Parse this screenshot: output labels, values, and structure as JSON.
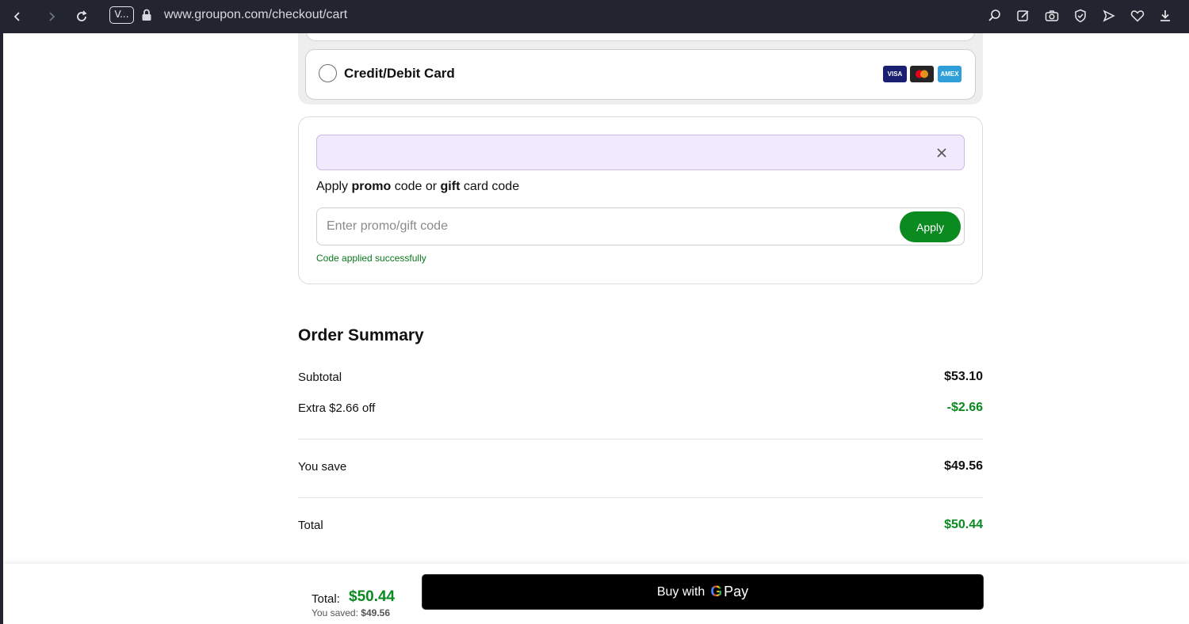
{
  "browser": {
    "url": "www.groupon.com/checkout/cart",
    "tab_badge": "V..."
  },
  "payment": {
    "option_label": "Credit/Debit Card",
    "card_logos": [
      {
        "name": "VISA",
        "color": "#1a1f71"
      },
      {
        "name": "mastercard",
        "color": "#252525"
      },
      {
        "name": "AMEX",
        "color": "#2e9fd8"
      }
    ]
  },
  "promo": {
    "title_parts": [
      "Apply ",
      "promo",
      " code or ",
      "gift",
      " card code"
    ],
    "input_value": "",
    "input_placeholder": "Enter promo/gift code",
    "apply_label": "Apply",
    "success_message": "Code applied successfully"
  },
  "summary": {
    "title": "Order Summary",
    "subtotal_label": "Subtotal",
    "subtotal_value": "$53.10",
    "discount_label": "Extra $2.66 off",
    "discount_value": "-$2.66",
    "save_label": "You save",
    "save_value": "$49.56",
    "total_label": "Total",
    "total_value": "$50.44"
  },
  "footer": {
    "total_label": "Total:",
    "total_value": "$50.44",
    "saved_label": "You saved:",
    "saved_value": "$49.56",
    "buy_label": "Buy with",
    "gpay_g": "G",
    "gpay_pay": "Pay"
  },
  "colors": {
    "accent_green": "#0a8a1f",
    "promo_banner_bg": "#f1e9fd"
  }
}
